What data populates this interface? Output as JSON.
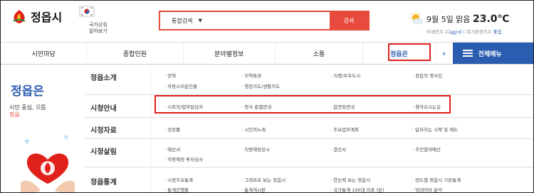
{
  "header": {
    "logo_text": "정읍시",
    "symbol_label_1": "국가상징",
    "symbol_label_2": "알아보기",
    "search": {
      "select": "통합검색",
      "button": "검색"
    },
    "weather": {
      "date": "9월 5일",
      "condition": "맑음",
      "temp": "23.0℃",
      "sub_prefix": "미세먼지 22",
      "sub_unit": "㎍/㎥",
      "sub_mid": " | 대기환경지수 ",
      "sub_grade": "좋음"
    }
  },
  "nav": {
    "items": [
      "시민마당",
      "종합민원",
      "분야별정보",
      "소통",
      "정읍은"
    ],
    "all_menu": "전체메뉴"
  },
  "left": {
    "title": "정읍은",
    "sub1": "시민 중심, 으뜸",
    "sub2": "정읍"
  },
  "menu": [
    {
      "head": "정읍소개",
      "links": [
        "연혁",
        "지역특성",
        "지명/우호도시",
        "정읍의 옛사진",
        "자랑스러운인물",
        "행정지도/생활지도"
      ]
    },
    {
      "head": "시청안내",
      "links": [
        "시조직/업무담당자",
        "청사 층별안내",
        "읍면동안내",
        "찾아오시는길"
      ]
    },
    {
      "head": "시정자료",
      "links": [
        "성장률",
        "시민의노래",
        "주요업무계획",
        "달라지는 시책 및 제도"
      ]
    },
    {
      "head": "시정살림",
      "links": [
        "예산서",
        "지방재정공시",
        "결산서",
        "주민참여예산",
        "지방재정 투자심사"
      ]
    },
    {
      "head": "정읍통계",
      "links": [
        "시정주요통계",
        "그래프로 보는 정읍시",
        "한눈에 보는 정읍시",
        "연도별 정읍시 기본통계",
        "통계간행물",
        "통계게시판",
        "국가통계 100대 지표 (본)",
        "빅데이터 분석"
      ]
    }
  ],
  "colors": {
    "accent": "#2a5db0",
    "search": "#e84a3e",
    "highlight": "#e0201b"
  }
}
